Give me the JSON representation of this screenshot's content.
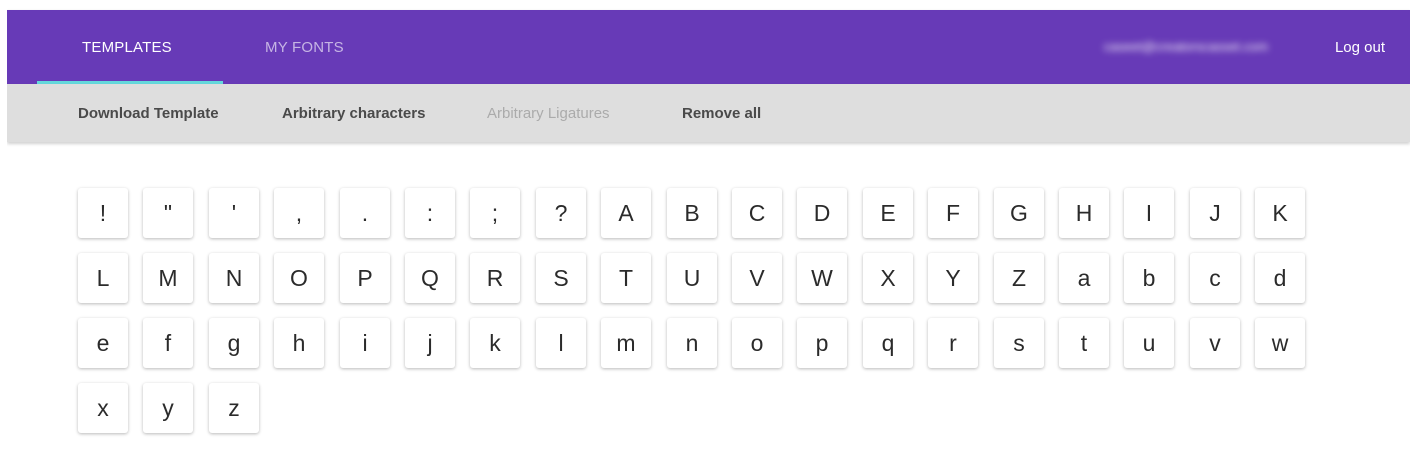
{
  "nav": {
    "tabs": [
      {
        "label": "TEMPLATES",
        "active": true
      },
      {
        "label": "MY FONTS",
        "active": false
      }
    ],
    "user_email": "caseet@creatorscasset.com",
    "logout_label": "Log out",
    "bar_color": "#673ab7",
    "indicator_color": "#64d8dc"
  },
  "toolbar": {
    "items": [
      {
        "label": "Download Template",
        "enabled": true
      },
      {
        "label": "Arbitrary characters",
        "enabled": true
      },
      {
        "label": "Arbitrary Ligatures",
        "enabled": false
      },
      {
        "label": "Remove all",
        "enabled": true
      }
    ]
  },
  "glyphs": [
    "!",
    "\"",
    "'",
    ",",
    ".",
    ":",
    ";",
    "?",
    "A",
    "B",
    "C",
    "D",
    "E",
    "F",
    "G",
    "H",
    "I",
    "J",
    "K",
    "L",
    "M",
    "N",
    "O",
    "P",
    "Q",
    "R",
    "S",
    "T",
    "U",
    "V",
    "W",
    "X",
    "Y",
    "Z",
    "a",
    "b",
    "c",
    "d",
    "e",
    "f",
    "g",
    "h",
    "i",
    "j",
    "k",
    "l",
    "m",
    "n",
    "o",
    "p",
    "q",
    "r",
    "s",
    "t",
    "u",
    "v",
    "w",
    "x",
    "y",
    "z"
  ]
}
